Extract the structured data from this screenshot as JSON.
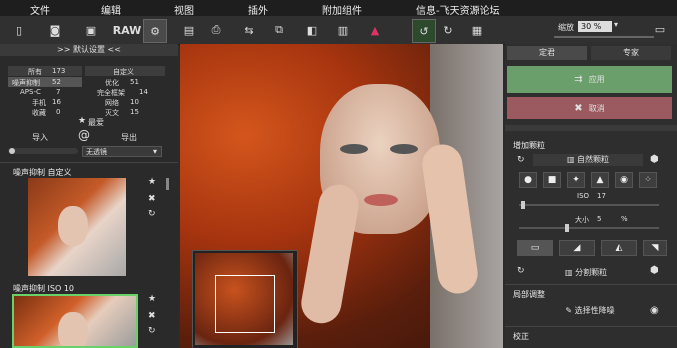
{
  "menubar": {
    "items": [
      {
        "label": "文件"
      },
      {
        "label": "编辑"
      },
      {
        "label": "视图"
      },
      {
        "label": "插外"
      },
      {
        "label": "附加组件"
      },
      {
        "label": "信息-飞天资源论坛"
      }
    ]
  },
  "toolbar": {
    "raw_label": "RAW",
    "zoom_label": "缩放",
    "zoom_value": "30 %"
  },
  "left_panel": {
    "header": ">> 默认设置 <<",
    "stats": [
      {
        "label": "所有",
        "value": "173",
        "label2": "自定义",
        "value2": ""
      },
      {
        "label": "噪声抑制",
        "value": "52",
        "label2": "优化",
        "value2": "51"
      },
      {
        "label": "APS-C",
        "value": "7",
        "label2": "完全框架",
        "value2": "14"
      },
      {
        "label": "手机",
        "value": "16",
        "label2": "网络",
        "value2": "10"
      },
      {
        "label": "收藏",
        "value": "0",
        "label2": "灭文",
        "value2": "15"
      }
    ],
    "import_label": "导入",
    "export_label": "导出",
    "favorites_label": "最爱",
    "dropdown_value": "无透镜",
    "presets": [
      {
        "title": "噪声抑制  自定义"
      },
      {
        "title": "噪声抑制  ISO 10"
      }
    ]
  },
  "right_panel": {
    "tabs": [
      {
        "label": "定君"
      },
      {
        "label": "专家"
      }
    ],
    "apply_label": "应用",
    "cancel_label": "取消",
    "grain_section": "增加颗粒",
    "grain_mode": "自然颗粒",
    "iso_label": "ISO",
    "iso_value": "17",
    "size_label": "大小",
    "size_value": "5",
    "size_unit": "%",
    "split_grain_label": "分割颗粒",
    "local_adjust_label": "局部调整",
    "selective_denoise_label": "选择性降噪",
    "correction_label": "校正"
  },
  "colors": {
    "apply_green": "#6a9e6a",
    "cancel_red": "#9a5a60",
    "hair_orange": "#c24a1a"
  }
}
